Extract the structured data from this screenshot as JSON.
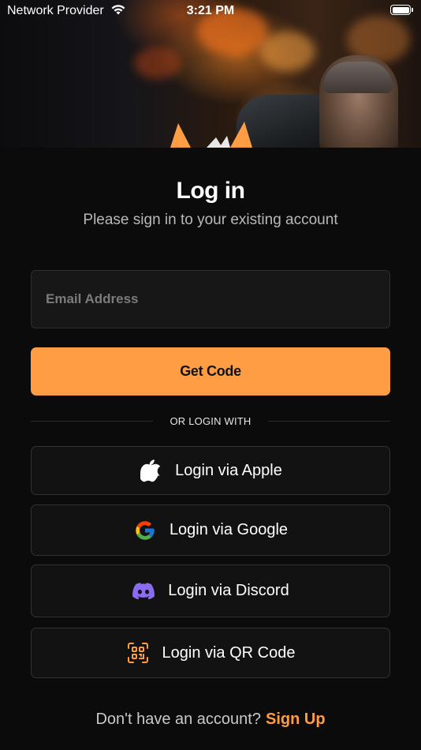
{
  "status_bar": {
    "carrier": "Network Provider",
    "time": "3:21 PM",
    "wifi_icon": "wifi-icon",
    "battery_icon": "battery-icon"
  },
  "header": {
    "title": "Log in",
    "subtitle": "Please sign in to your existing account"
  },
  "form": {
    "email_placeholder": "Email Address",
    "email_value": "",
    "submit_label": "Get Code"
  },
  "divider": {
    "label": "OR LOGIN WITH"
  },
  "social_logins": [
    {
      "label": "Login via Apple",
      "icon": "apple-icon"
    },
    {
      "label": "Login via Google",
      "icon": "google-icon"
    },
    {
      "label": "Login via Discord",
      "icon": "discord-icon"
    },
    {
      "label": "Login via QR Code",
      "icon": "qr-code-icon"
    }
  ],
  "footer": {
    "prompt": "Don't have an account?",
    "signup_label": "Sign Up"
  },
  "colors": {
    "background": "#0b0b0b",
    "accent": "#ff9d45",
    "input_background": "#171717",
    "button_border": "#323232",
    "discord": "#8b6cf0"
  }
}
